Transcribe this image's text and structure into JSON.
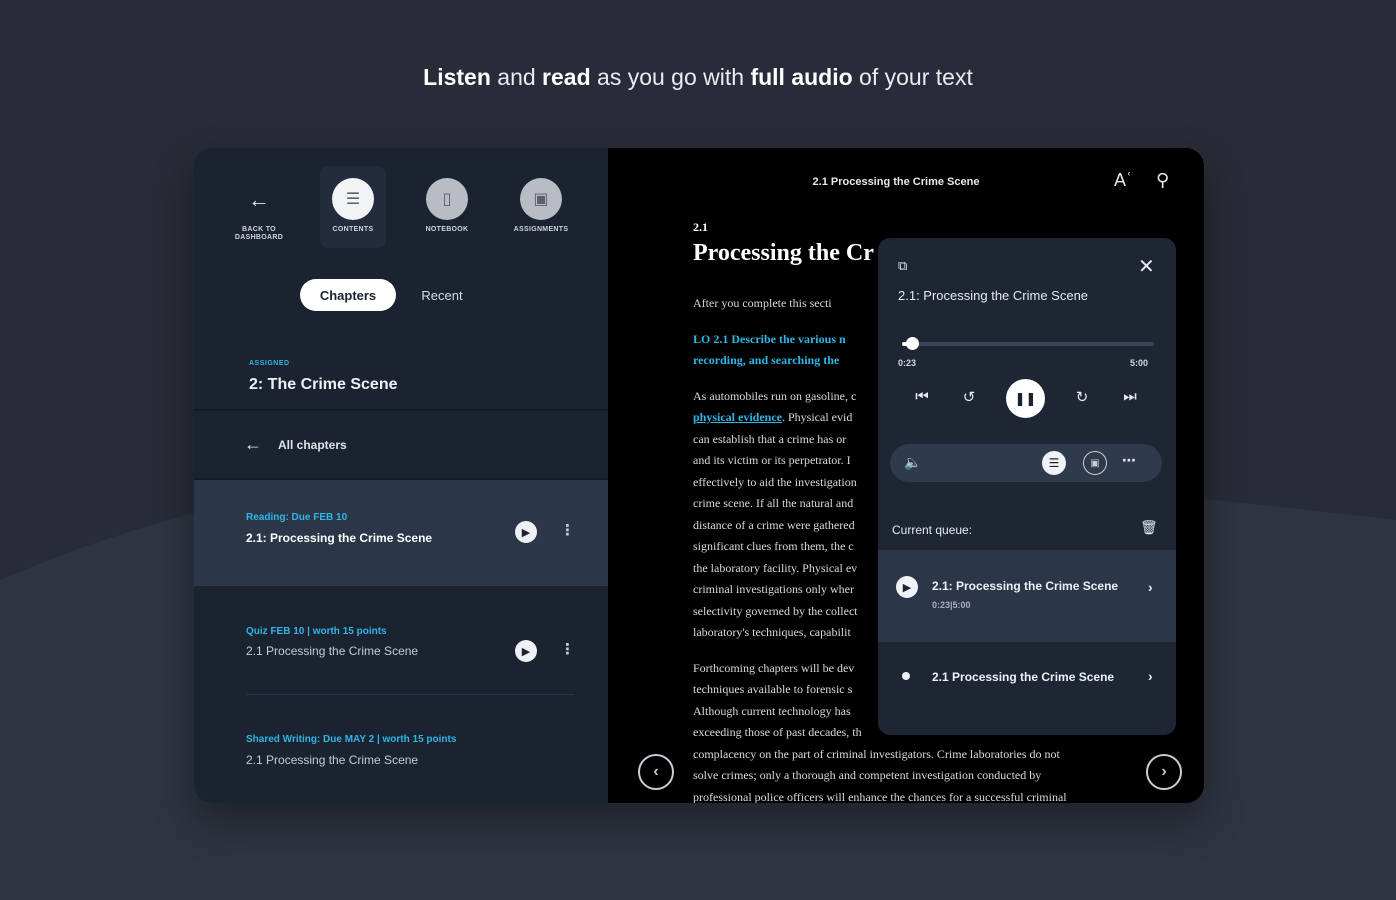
{
  "headline": {
    "w1": "Listen",
    "t1": " and ",
    "w2": "read",
    "t2": " as you go with ",
    "w3": "full audio",
    "t3": " of your text"
  },
  "sidebar": {
    "nav": [
      {
        "label": "BACK TO\nDASHBOARD",
        "icon": "arrow-left-icon"
      },
      {
        "label": "CONTENTS",
        "icon": "contents-icon"
      },
      {
        "label": "NOTEBOOK",
        "icon": "notebook-icon"
      },
      {
        "label": "ASSIGNMENTS",
        "icon": "calendar-icon"
      }
    ],
    "tabs": {
      "chapters": "Chapters",
      "recent": "Recent"
    },
    "assigned_tag": "ASSIGNED",
    "chapter_title": "2: The Crime Scene",
    "all_chapters": "All chapters",
    "items": [
      {
        "meta": "Reading: Due FEB 10",
        "name": "2.1: Processing the Crime Scene"
      },
      {
        "meta": "Quiz FEB 10 | worth 15 points",
        "name": "2.1  Processing the Crime Scene"
      },
      {
        "meta": "Shared Writing: Due MAY 2 | worth 15 points",
        "name": "2.1  Processing the Crime Scene"
      }
    ]
  },
  "reader": {
    "book_title": "2.1 Processing the Crime Scene",
    "section_number": "2.1",
    "section_title": "Processing the Cr",
    "intro": "After you complete this secti",
    "lo_line1": "LO 2.1 Describe the various n",
    "lo_line2": "recording, and searching the",
    "p1_lines": [
      "As automobiles run on gasoline, c",
      "physical evidence",
      ". Physical evid",
      "can establish that a crime has or",
      "and its victim or its perpetrator. I",
      "effectively to aid the investigation",
      "crime scene. If all the natural and",
      "distance of a crime were gathered",
      "significant clues from them, the c",
      "the laboratory facility. Physical ev",
      "criminal investigations only wher",
      "selectivity governed by the collect",
      "laboratory's techniques, capabilit"
    ],
    "p2_lines": [
      "Forthcoming chapters will be dev",
      "techniques available to forensic s",
      "Although current technology has",
      "exceeding those of past decades, th",
      "complacency on the part of criminal investigators. Crime laboratories do not",
      "solve crimes; only a thorough and competent investigation conducted by",
      "professional police officers will enhance the chances for a successful criminal"
    ]
  },
  "player": {
    "track": "2.1: Processing the Crime Scene",
    "elapsed": "0:23",
    "duration": "5:00",
    "progress": 0.04,
    "queue_label": "Current queue:",
    "queue": [
      {
        "title": "2.1: Processing the Crime Scene",
        "time": "0:23|5:00"
      },
      {
        "title": "2.1  Processing the Crime Scene",
        "time": ""
      }
    ]
  },
  "colors": {
    "accent": "#2fb6e6",
    "bg": "#272c38",
    "sidebar": "#1b2230",
    "selected": "#2b3648"
  }
}
